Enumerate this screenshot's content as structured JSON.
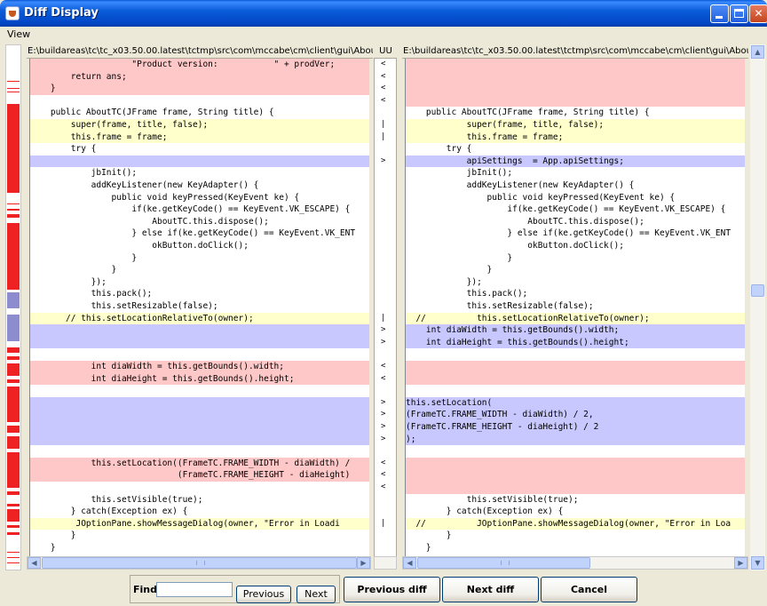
{
  "window": {
    "title": "Diff Display"
  },
  "menu": {
    "view_label": "View"
  },
  "left": {
    "path": "E:\\buildareas\\tc\\tc_x03.50.00.latest\\tctmp\\src\\com\\mccabe\\cm\\client\\gui\\AboutTC.java-javac..."
  },
  "right": {
    "path": "E:\\buildareas\\tc\\tc_x03.50.00.latest\\tctmp\\src\\com\\mccabe\\cm\\client\\gui\\AboutTC.java-javac..."
  },
  "marker_header": "UU",
  "find": {
    "label": "Find:",
    "value": ""
  },
  "buttons": {
    "previous": "Previous",
    "next": "Next",
    "previous_diff": "Previous diff",
    "next_diff": "Next diff",
    "cancel": "Cancel"
  },
  "colors": {
    "removed": "#ffc8c8",
    "changed": "#ffffcc",
    "added": "#c8c8ff",
    "overview_mark": "#ee2222"
  },
  "lines": [
    {
      "left": "                    \"Product version:           \" + prodVer;",
      "left_bg": "red",
      "marker": "<",
      "right": "",
      "right_bg": "red"
    },
    {
      "left": "        return ans;",
      "left_bg": "red",
      "marker": "<",
      "right": "",
      "right_bg": "red"
    },
    {
      "left": "    }",
      "left_bg": "red",
      "marker": "<",
      "right": "",
      "right_bg": "red"
    },
    {
      "left": "",
      "left_bg": "",
      "marker": "<",
      "right": "",
      "right_bg": "red"
    },
    {
      "left": "    public AboutTC(JFrame frame, String title) {",
      "left_bg": "",
      "marker": "",
      "right": "    public AboutTC(JFrame frame, String title) {",
      "right_bg": ""
    },
    {
      "left": "        super(frame, title, false);",
      "left_bg": "yellow",
      "marker": "|",
      "right": "            super(frame, title, false);",
      "right_bg": "yellow"
    },
    {
      "left": "        this.frame = frame;",
      "left_bg": "yellow",
      "marker": "|",
      "right": "            this.frame = frame;",
      "right_bg": "yellow"
    },
    {
      "left": "        try {",
      "left_bg": "",
      "marker": "",
      "right": "        try {",
      "right_bg": ""
    },
    {
      "left": "",
      "left_bg": "blue",
      "marker": ">",
      "right": "            apiSettings  = App.apiSettings;",
      "right_bg": "blue"
    },
    {
      "left": "            jbInit();",
      "left_bg": "",
      "marker": "",
      "right": "            jbInit();",
      "right_bg": ""
    },
    {
      "left": "            addKeyListener(new KeyAdapter() {",
      "left_bg": "",
      "marker": "",
      "right": "            addKeyListener(new KeyAdapter() {",
      "right_bg": ""
    },
    {
      "left": "                public void keyPressed(KeyEvent ke) {",
      "left_bg": "",
      "marker": "",
      "right": "                public void keyPressed(KeyEvent ke) {",
      "right_bg": ""
    },
    {
      "left": "                    if(ke.getKeyCode() == KeyEvent.VK_ESCAPE) {",
      "left_bg": "",
      "marker": "",
      "right": "                    if(ke.getKeyCode() == KeyEvent.VK_ESCAPE) {",
      "right_bg": ""
    },
    {
      "left": "                        AboutTC.this.dispose();",
      "left_bg": "",
      "marker": "",
      "right": "                        AboutTC.this.dispose();",
      "right_bg": ""
    },
    {
      "left": "                    } else if(ke.getKeyCode() == KeyEvent.VK_ENT",
      "left_bg": "",
      "marker": "",
      "right": "                    } else if(ke.getKeyCode() == KeyEvent.VK_ENT",
      "right_bg": ""
    },
    {
      "left": "                        okButton.doClick();",
      "left_bg": "",
      "marker": "",
      "right": "                        okButton.doClick();",
      "right_bg": ""
    },
    {
      "left": "                    }",
      "left_bg": "",
      "marker": "",
      "right": "                    }",
      "right_bg": ""
    },
    {
      "left": "                }",
      "left_bg": "",
      "marker": "",
      "right": "                }",
      "right_bg": ""
    },
    {
      "left": "            });",
      "left_bg": "",
      "marker": "",
      "right": "            });",
      "right_bg": ""
    },
    {
      "left": "            this.pack();",
      "left_bg": "",
      "marker": "",
      "right": "            this.pack();",
      "right_bg": ""
    },
    {
      "left": "            this.setResizable(false);",
      "left_bg": "",
      "marker": "",
      "right": "            this.setResizable(false);",
      "right_bg": ""
    },
    {
      "left": "       // this.setLocationRelativeTo(owner);",
      "left_bg": "yellow",
      "marker": "|",
      "right": "  //          this.setLocationRelativeTo(owner);",
      "right_bg": "yellow"
    },
    {
      "left": "",
      "left_bg": "blue",
      "marker": ">",
      "right": "    int diaWidth = this.getBounds().width;",
      "right_bg": "blue"
    },
    {
      "left": "",
      "left_bg": "blue",
      "marker": ">",
      "right": "    int diaHeight = this.getBounds().height;",
      "right_bg": "blue"
    },
    {
      "left": "",
      "left_bg": "",
      "marker": "",
      "right": "",
      "right_bg": ""
    },
    {
      "left": "            int diaWidth = this.getBounds().width;",
      "left_bg": "red",
      "marker": "<",
      "right": "",
      "right_bg": "red"
    },
    {
      "left": "            int diaHeight = this.getBounds().height;",
      "left_bg": "red",
      "marker": "<",
      "right": "",
      "right_bg": "red"
    },
    {
      "left": "",
      "left_bg": "",
      "marker": "",
      "right": "",
      "right_bg": ""
    },
    {
      "left": "",
      "left_bg": "blue",
      "marker": ">",
      "right": "this.setLocation(",
      "right_bg": "blue"
    },
    {
      "left": "",
      "left_bg": "blue",
      "marker": ">",
      "right": "(FrameTC.FRAME_WIDTH - diaWidth) / 2,",
      "right_bg": "blue"
    },
    {
      "left": "",
      "left_bg": "blue",
      "marker": ">",
      "right": "(FrameTC.FRAME_HEIGHT - diaHeight) / 2",
      "right_bg": "blue"
    },
    {
      "left": "",
      "left_bg": "blue",
      "marker": ">",
      "right": ");",
      "right_bg": "blue"
    },
    {
      "left": "",
      "left_bg": "",
      "marker": "",
      "right": "",
      "right_bg": ""
    },
    {
      "left": "            this.setLocation((FrameTC.FRAME_WIDTH - diaWidth) /",
      "left_bg": "red",
      "marker": "<",
      "right": "",
      "right_bg": "red"
    },
    {
      "left": "                             (FrameTC.FRAME_HEIGHT - diaHeight)",
      "left_bg": "red",
      "marker": "<",
      "right": "",
      "right_bg": "red"
    },
    {
      "left": "",
      "left_bg": "",
      "marker": "<",
      "right": "",
      "right_bg": "red"
    },
    {
      "left": "            this.setVisible(true);",
      "left_bg": "",
      "marker": "",
      "right": "            this.setVisible(true);",
      "right_bg": ""
    },
    {
      "left": "        } catch(Exception ex) {",
      "left_bg": "",
      "marker": "",
      "right": "        } catch(Exception ex) {",
      "right_bg": ""
    },
    {
      "left": "         JOptionPane.showMessageDialog(owner, \"Error in Loadi",
      "left_bg": "yellow",
      "marker": "|",
      "right": "  //          JOptionPane.showMessageDialog(owner, \"Error in Loa",
      "right_bg": "yellow"
    },
    {
      "left": "        }",
      "left_bg": "",
      "marker": "",
      "right": "        }",
      "right_bg": ""
    },
    {
      "left": "    }",
      "left_bg": "",
      "marker": "",
      "right": "    }",
      "right_bg": ""
    }
  ]
}
